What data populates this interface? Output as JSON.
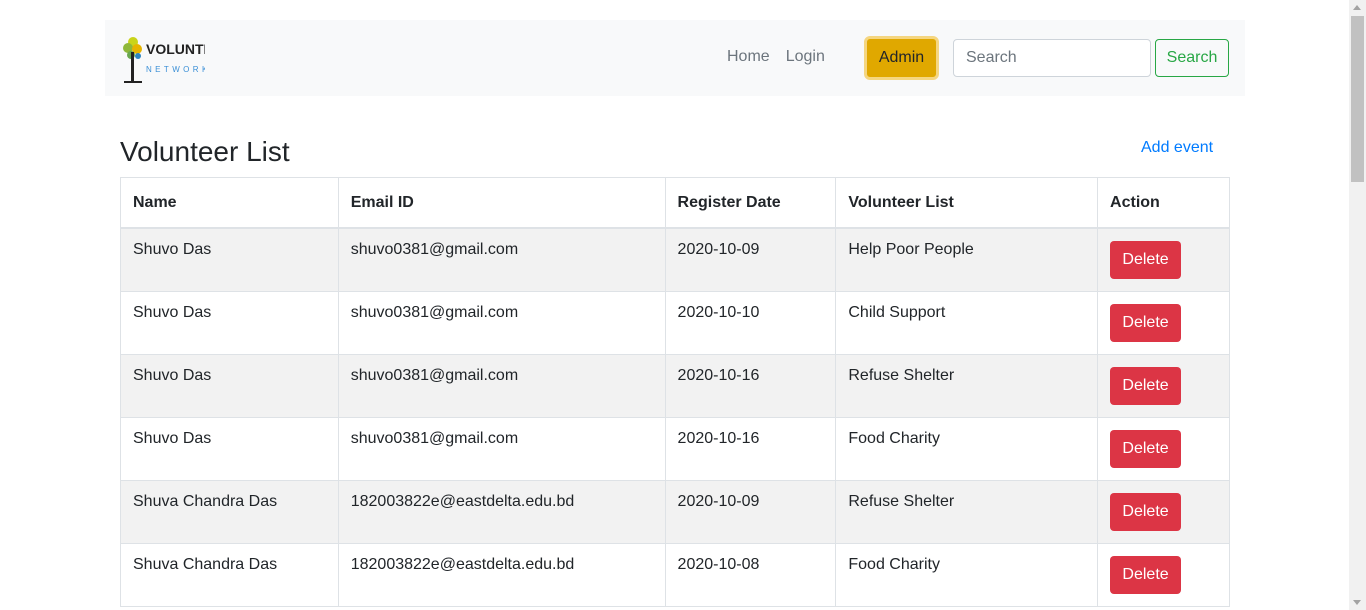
{
  "header": {
    "logo_text": "VOLUNTEER",
    "logo_subtext": "NETWORK",
    "nav": {
      "home": "Home",
      "login": "Login"
    },
    "admin_label": "Admin",
    "search": {
      "placeholder": "Search",
      "value": "",
      "button_label": "Search"
    },
    "colors": {
      "admin": "#e0a800",
      "search_button": "#28a745"
    }
  },
  "main": {
    "title": "Volunteer List",
    "add_event_link": "Add event",
    "table": {
      "columns": [
        "Name",
        "Email ID",
        "Register Date",
        "Volunteer List",
        "Action"
      ],
      "rows": [
        {
          "name": "Shuvo Das",
          "email": "shuvo0381@gmail.com",
          "date": "2020-10-09",
          "event": "Help Poor People",
          "action": "Delete"
        },
        {
          "name": "Shuvo Das",
          "email": "shuvo0381@gmail.com",
          "date": "2020-10-10",
          "event": "Child Support",
          "action": "Delete"
        },
        {
          "name": "Shuvo Das",
          "email": "shuvo0381@gmail.com",
          "date": "2020-10-16",
          "event": "Refuse Shelter",
          "action": "Delete"
        },
        {
          "name": "Shuvo Das",
          "email": "shuvo0381@gmail.com",
          "date": "2020-10-16",
          "event": "Food Charity",
          "action": "Delete"
        },
        {
          "name": "Shuva Chandra Das",
          "email": "182003822e@eastdelta.edu.bd",
          "date": "2020-10-09",
          "event": "Refuse Shelter",
          "action": "Delete"
        },
        {
          "name": "Shuva Chandra Das",
          "email": "182003822e@eastdelta.edu.bd",
          "date": "2020-10-08",
          "event": "Food Charity",
          "action": "Delete"
        }
      ]
    },
    "colors": {
      "delete": "#dc3545",
      "link": "#007bff"
    }
  }
}
